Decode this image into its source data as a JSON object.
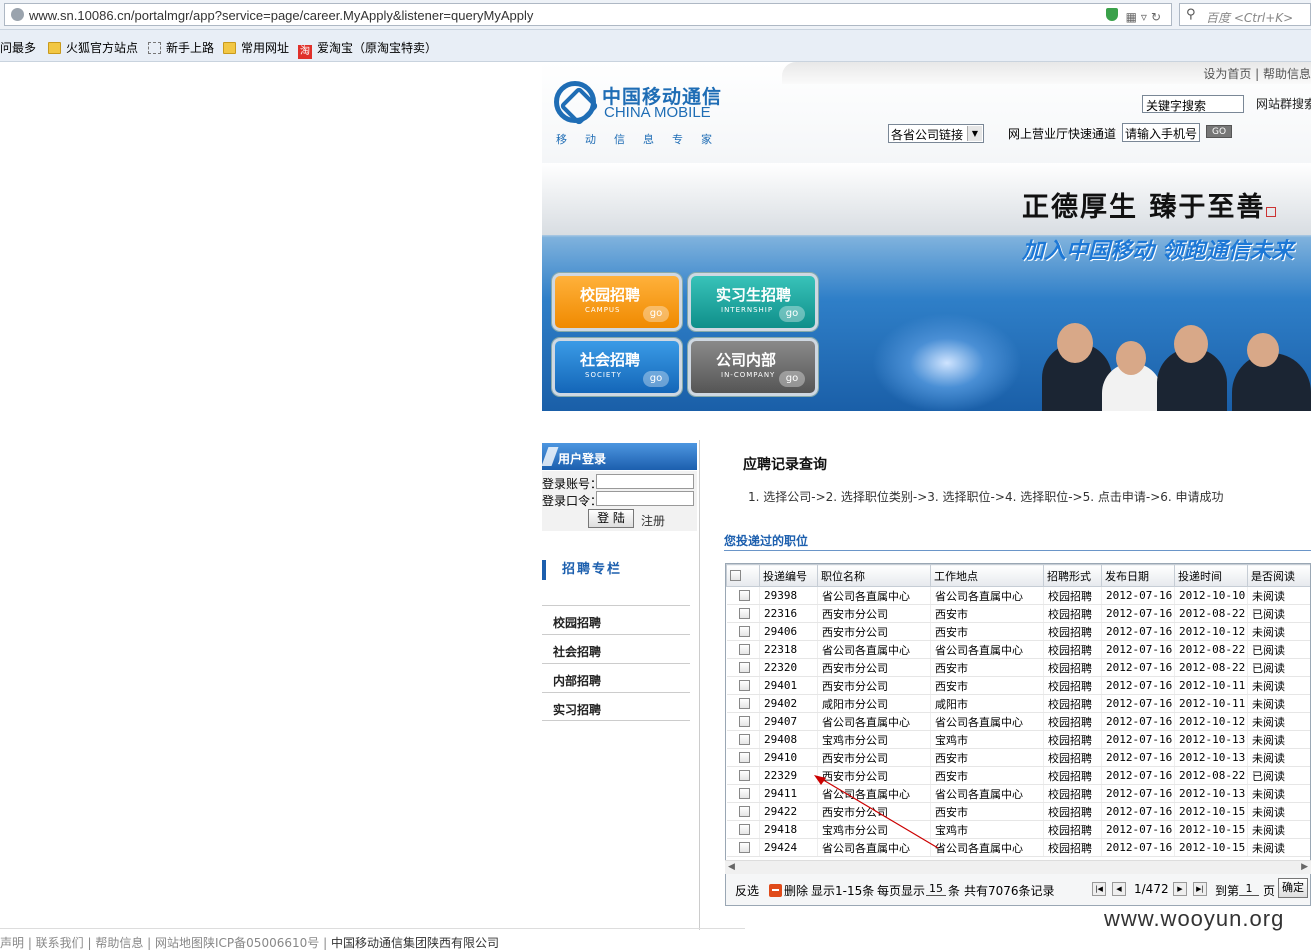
{
  "browser": {
    "url": "www.sn.10086.cn/portalmgr/app?service=page/career.MyApply&listener=queryMyApply",
    "search_placeholder": "百度 <Ctrl+K>",
    "bookmarks": [
      "访问最多",
      "火狐官方站点",
      "新手上路",
      "常用网址",
      "爱淘宝（原淘宝特卖）"
    ]
  },
  "header": {
    "top_links": "设为首页 | 帮助信息",
    "logo_cn": "中国移动通信",
    "logo_en": "CHINA MOBILE",
    "logo_sub": "移动信息专家",
    "keyword_placeholder": "关键字搜索",
    "site_search": "网站群搜索",
    "province_select": "各省公司链接",
    "quick_label": "网上营业厅快速通道",
    "phone_placeholder": "请输入手机号",
    "go_label": "GO"
  },
  "banner": {
    "slogan1": "正德厚生 臻于至善",
    "slogan2": "加入中国移动 领跑通信未来",
    "buttons": [
      {
        "title": "校园招聘",
        "sub": "CAMPUS",
        "go": "go"
      },
      {
        "title": "实习生招聘",
        "sub": "INTERNSHIP",
        "go": "go"
      },
      {
        "title": "社会招聘",
        "sub": "SOCIETY",
        "go": "go"
      },
      {
        "title": "公司内部",
        "sub": "IN-COMPANY",
        "go": "go"
      }
    ]
  },
  "login": {
    "title": "用户登录",
    "account_label": "登录账号：",
    "password_label": "登录口令：",
    "login_button": "登 陆",
    "register": "注册"
  },
  "sidebar": {
    "title": "招聘专栏",
    "items": [
      "校园招聘",
      "社会招聘",
      "内部招聘",
      "实习招聘"
    ]
  },
  "main": {
    "title": "应聘记录查询",
    "steps": "1. 选择公司->2. 选择职位类别->3. 选择职位->4. 选择职位->5. 点击申请->6. 申请成功",
    "posted_title": "您投递过的职位"
  },
  "table": {
    "headers": [
      "投递编号",
      "职位名称",
      "工作地点",
      "招聘形式",
      "发布日期",
      "投递时间",
      "是否阅读"
    ],
    "rows": [
      [
        "29398",
        "省公司各直属中心",
        "省公司各直属中心",
        "校园招聘",
        "2012-07-16",
        "2012-10-10",
        "未阅读"
      ],
      [
        "22316",
        "西安市分公司",
        "西安市",
        "校园招聘",
        "2012-07-16",
        "2012-08-22",
        "已阅读"
      ],
      [
        "29406",
        "西安市分公司",
        "西安市",
        "校园招聘",
        "2012-07-16",
        "2012-10-12",
        "未阅读"
      ],
      [
        "22318",
        "省公司各直属中心",
        "省公司各直属中心",
        "校园招聘",
        "2012-07-16",
        "2012-08-22",
        "已阅读"
      ],
      [
        "22320",
        "西安市分公司",
        "西安市",
        "校园招聘",
        "2012-07-16",
        "2012-08-22",
        "已阅读"
      ],
      [
        "29401",
        "西安市分公司",
        "西安市",
        "校园招聘",
        "2012-07-16",
        "2012-10-11",
        "未阅读"
      ],
      [
        "29402",
        "咸阳市分公司",
        "咸阳市",
        "校园招聘",
        "2012-07-16",
        "2012-10-11",
        "未阅读"
      ],
      [
        "29407",
        "省公司各直属中心",
        "省公司各直属中心",
        "校园招聘",
        "2012-07-16",
        "2012-10-12",
        "未阅读"
      ],
      [
        "29408",
        "宝鸡市分公司",
        "宝鸡市",
        "校园招聘",
        "2012-07-16",
        "2012-10-13",
        "未阅读"
      ],
      [
        "29410",
        "西安市分公司",
        "西安市",
        "校园招聘",
        "2012-07-16",
        "2012-10-13",
        "未阅读"
      ],
      [
        "22329",
        "西安市分公司",
        "西安市",
        "校园招聘",
        "2012-07-16",
        "2012-08-22",
        "已阅读"
      ],
      [
        "29411",
        "省公司各直属中心",
        "省公司各直属中心",
        "校园招聘",
        "2012-07-16",
        "2012-10-13",
        "未阅读"
      ],
      [
        "29422",
        "西安市分公司",
        "西安市",
        "校园招聘",
        "2012-07-16",
        "2012-10-15",
        "未阅读"
      ],
      [
        "29418",
        "宝鸡市分公司",
        "宝鸡市",
        "校园招聘",
        "2012-07-16",
        "2012-10-15",
        "未阅读"
      ],
      [
        "29424",
        "省公司各直属中心",
        "省公司各直属中心",
        "校园招聘",
        "2012-07-16",
        "2012-10-15",
        "未阅读"
      ]
    ]
  },
  "pager": {
    "invert": "反选",
    "delete": "删除",
    "showing": "显示1-15条",
    "per_page_label": "每页显示",
    "per_page": "15",
    "per_page_unit": "条",
    "total": "共有7076条记录",
    "page_info": "1/472",
    "goto_label": "到第",
    "goto_value": "1",
    "page_unit": "页",
    "confirm": "确定"
  },
  "footer": {
    "links": "声明 | 联系我们 | 帮助信息 | 网站地图陕ICP备05006610号 |",
    "company": "中国移动通信集团陕西有限公司"
  },
  "watermark": "www.wooyun.org",
  "colors": {
    "brand_blue": "#1c5fae",
    "accent_orange": "#f08a00",
    "annotation_red": "#cc0000"
  }
}
